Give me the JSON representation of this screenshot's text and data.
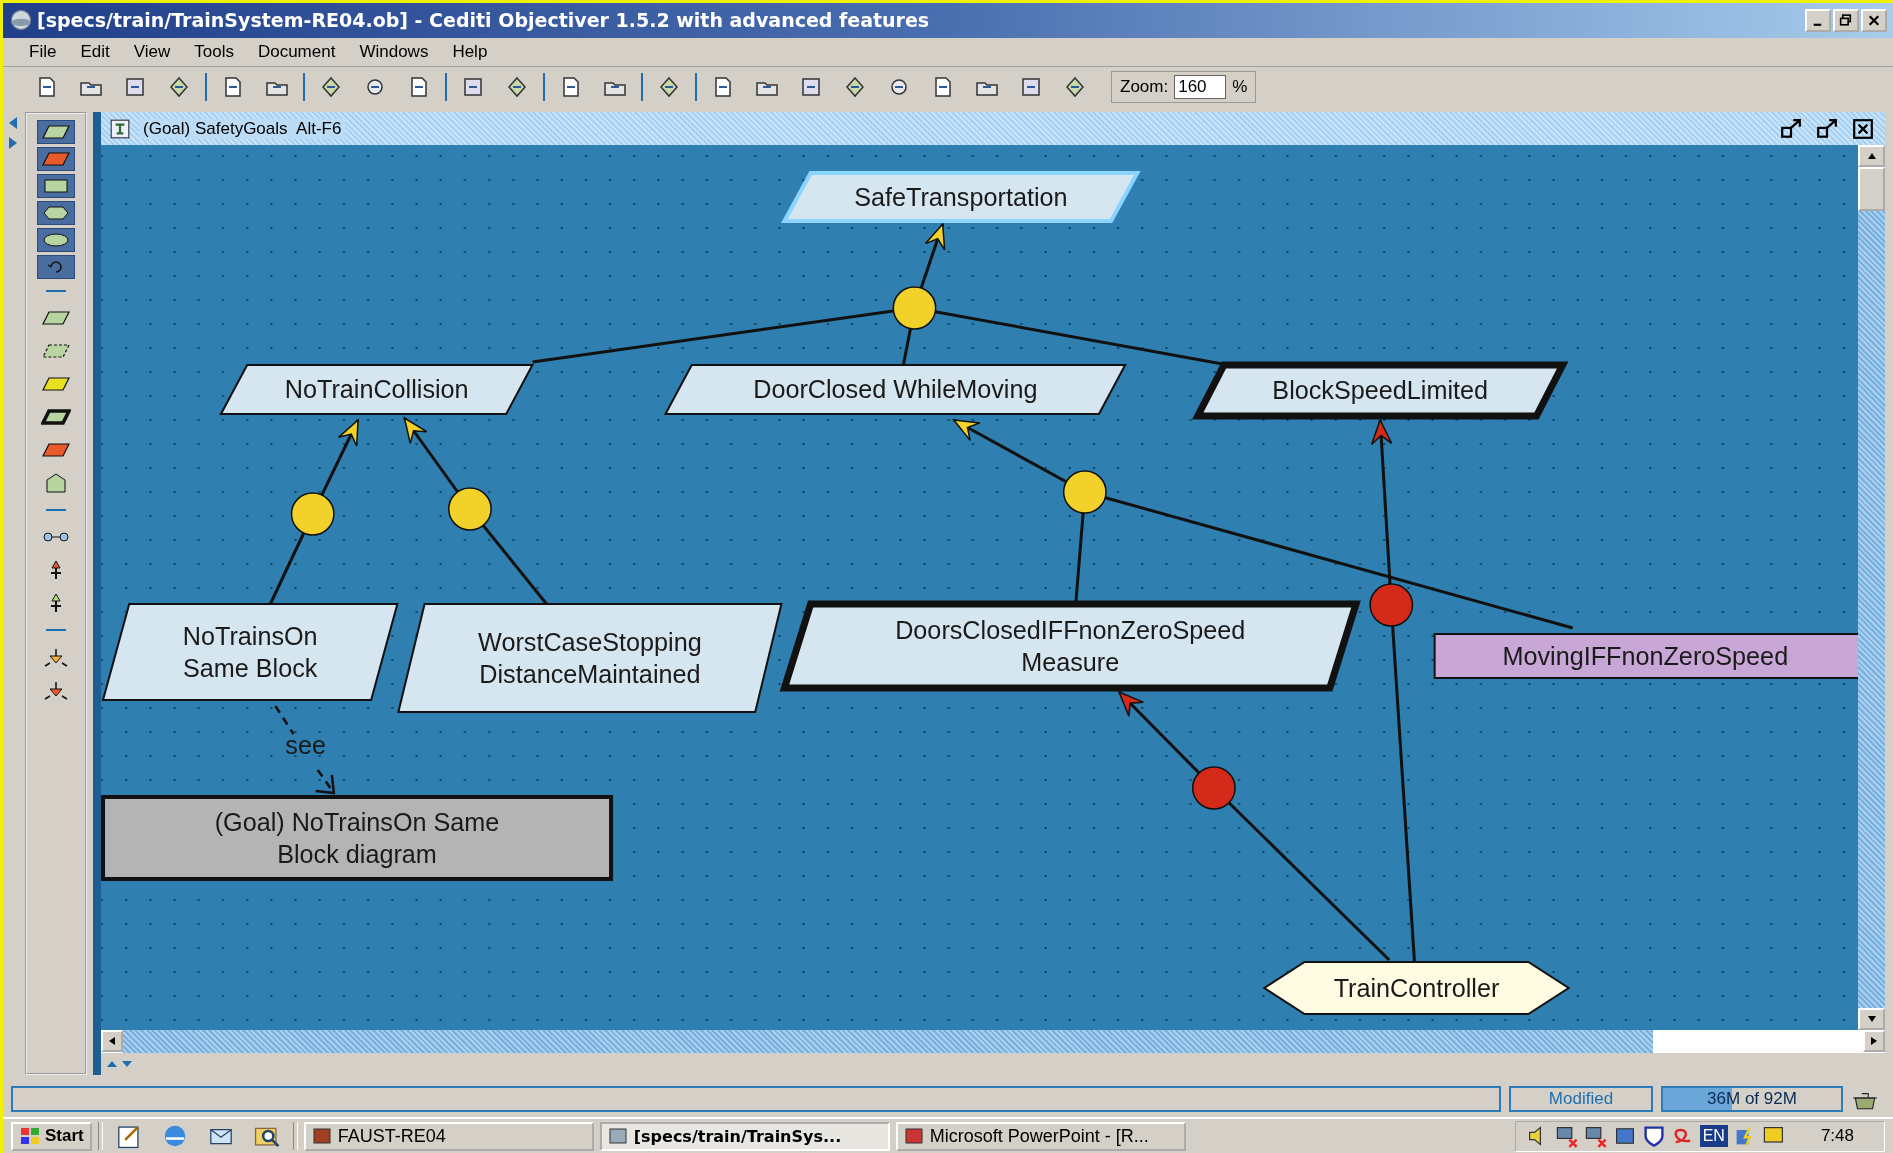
{
  "window": {
    "title": "[specs/train/TrainSystem-RE04.ob] - Cediti Objectiver 1.5.2 with advanced features"
  },
  "menu": [
    "File",
    "Edit",
    "View",
    "Tools",
    "Document",
    "Windows",
    "Help"
  ],
  "toolbar": {
    "zoom_label": "Zoom:",
    "zoom_value": "160",
    "zoom_unit": "%"
  },
  "document": {
    "title": "(Goal) SafetyGoals  Alt-F6",
    "nodes": [
      {
        "kind": "goal",
        "label": "SafeTransportation",
        "selected": true
      },
      {
        "kind": "goal",
        "label": "NoTrainCollision",
        "selected": false
      },
      {
        "kind": "goal",
        "label": "DoorClosed WhileMoving",
        "selected": false
      },
      {
        "kind": "requirement",
        "label": "BlockSpeedLimited",
        "selected": false
      },
      {
        "kind": "goal",
        "label": "NoTrainsOn\nSame Block",
        "selected": false
      },
      {
        "kind": "goal",
        "label": "WorstCaseStopping\nDistanceMaintained",
        "selected": false
      },
      {
        "kind": "requirement",
        "label": "DoorsClosedIFFnonZeroSpeed\nMeasure",
        "selected": false
      },
      {
        "kind": "expectation",
        "label": "MovingIFFnonZeroSpeed",
        "selected": false
      },
      {
        "kind": "reference",
        "label": "(Goal) NoTrainsOn Same\nBlock diagram",
        "selected": false
      },
      {
        "kind": "agent",
        "label": "TrainController",
        "selected": false
      }
    ],
    "connectors": [
      {
        "kind": "refinement"
      },
      {
        "kind": "refinement"
      },
      {
        "kind": "refinement"
      },
      {
        "kind": "refinement"
      },
      {
        "kind": "responsibility"
      },
      {
        "kind": "responsibility"
      }
    ],
    "see_label": "see"
  },
  "status_bar": {
    "state": "Modified",
    "memory": "36M of 92M",
    "level": 0.39
  },
  "taskbar": {
    "start": "Start",
    "tasks": [
      {
        "label": "FAUST-RE04",
        "selected": false
      },
      {
        "label": "[specs/train/TrainSys...",
        "selected": true
      },
      {
        "label": "Microsoft PowerPoint - [R...",
        "selected": false
      }
    ],
    "language": "EN",
    "clock": "7:48"
  }
}
